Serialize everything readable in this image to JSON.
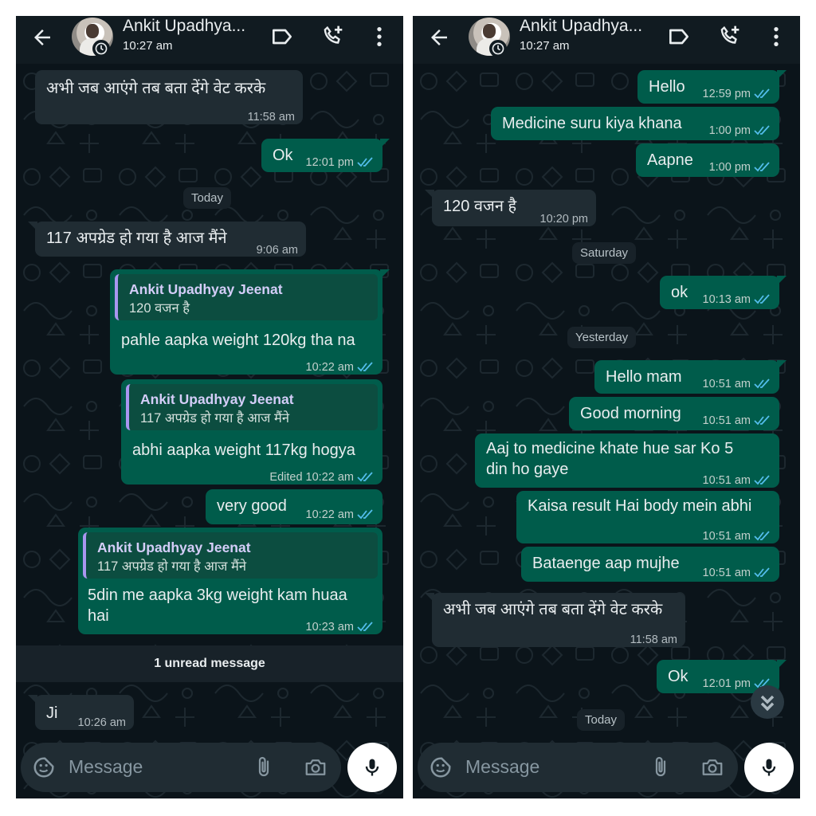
{
  "colors": {
    "background": "#0b141a",
    "header": "#111b21",
    "incoming_bubble": "#202c33",
    "outgoing_bubble": "#005c4b",
    "quote_accent": "#a996f0",
    "read_ticks": "#53bdeb"
  },
  "icons": {
    "back": "arrow-left-icon",
    "label": "label-tag-icon",
    "call": "add-call-icon",
    "more": "more-vertical-icon",
    "emoji": "sticker-icon",
    "attach": "paperclip-icon",
    "camera": "camera-icon",
    "mic": "microphone-icon",
    "scroll": "double-chevron-down-icon",
    "ticks": "double-check-icon"
  },
  "left": {
    "header": {
      "name": "Ankit Upadhya...",
      "status": "10:27 am"
    },
    "messages": [
      {
        "dir": "in",
        "text": "अभी जब आएंगे तब बता देंगे वेट करके",
        "time": "11:58 am"
      },
      {
        "dir": "out",
        "text": "Ok",
        "time": "12:01 pm"
      },
      {
        "dir": "in",
        "text": "117 अपग्रेड हो गया है आज मैंने",
        "time": "9:06 am"
      },
      {
        "dir": "out",
        "quote_name": "Ankit Upadhyay Jeenat",
        "quote_text": "120 वजन है",
        "text": "pahle aapka weight 120kg tha na",
        "time": "10:22 am"
      },
      {
        "dir": "out",
        "quote_name": "Ankit Upadhyay Jeenat",
        "quote_text": "117 अपग्रेड हो गया है आज मैंने",
        "text": "abhi aapka weight 117kg hogya",
        "edited": "Edited",
        "time": "10:22 am"
      },
      {
        "dir": "out",
        "text": "very good",
        "time": "10:22 am"
      },
      {
        "dir": "out",
        "quote_name": "Ankit Upadhyay Jeenat",
        "quote_text": "117 अपग्रेड हो गया है आज मैंने",
        "text_line1": "5din me aapka 3kg weight kam huaa",
        "text_line2": "hai",
        "time": "10:23 am"
      },
      {
        "dir": "in",
        "text": "Ji",
        "time": "10:26 am"
      }
    ],
    "date_today": "Today",
    "unread": "1 unread message",
    "input_placeholder": "Message"
  },
  "right": {
    "header": {
      "name": "Ankit Upadhya...",
      "status": "10:27 am"
    },
    "messages": [
      {
        "dir": "out",
        "text": "Hello",
        "time": "12:59 pm"
      },
      {
        "dir": "out",
        "text": "Medicine suru kiya khana",
        "time": "1:00 pm"
      },
      {
        "dir": "out",
        "text": "Aapne",
        "time": "1:00 pm"
      },
      {
        "dir": "in",
        "text": "120 वजन है",
        "time": "10:20 pm"
      },
      {
        "dir": "out",
        "text": "ok",
        "time": "10:13 am"
      },
      {
        "dir": "out",
        "text": "Hello mam",
        "time": "10:51 am"
      },
      {
        "dir": "out",
        "text": "Good morning",
        "time": "10:51 am"
      },
      {
        "dir": "out",
        "text_line1": "Aaj to medicine khate hue sar Ko 5",
        "text_line2": "din ho gaye",
        "time": "10:51 am"
      },
      {
        "dir": "out",
        "text": "Kaisa result Hai body mein abhi",
        "time": "10:51 am"
      },
      {
        "dir": "out",
        "text": "Bataenge aap mujhe",
        "time": "10:51 am"
      },
      {
        "dir": "in",
        "text": "अभी जब आएंगे तब बता देंगे वेट करके",
        "time": "11:58 am"
      },
      {
        "dir": "out",
        "text": "Ok",
        "time": "12:01 pm"
      }
    ],
    "date_saturday": "Saturday",
    "date_yesterday": "Yesterday",
    "date_today": "Today",
    "input_placeholder": "Message"
  }
}
